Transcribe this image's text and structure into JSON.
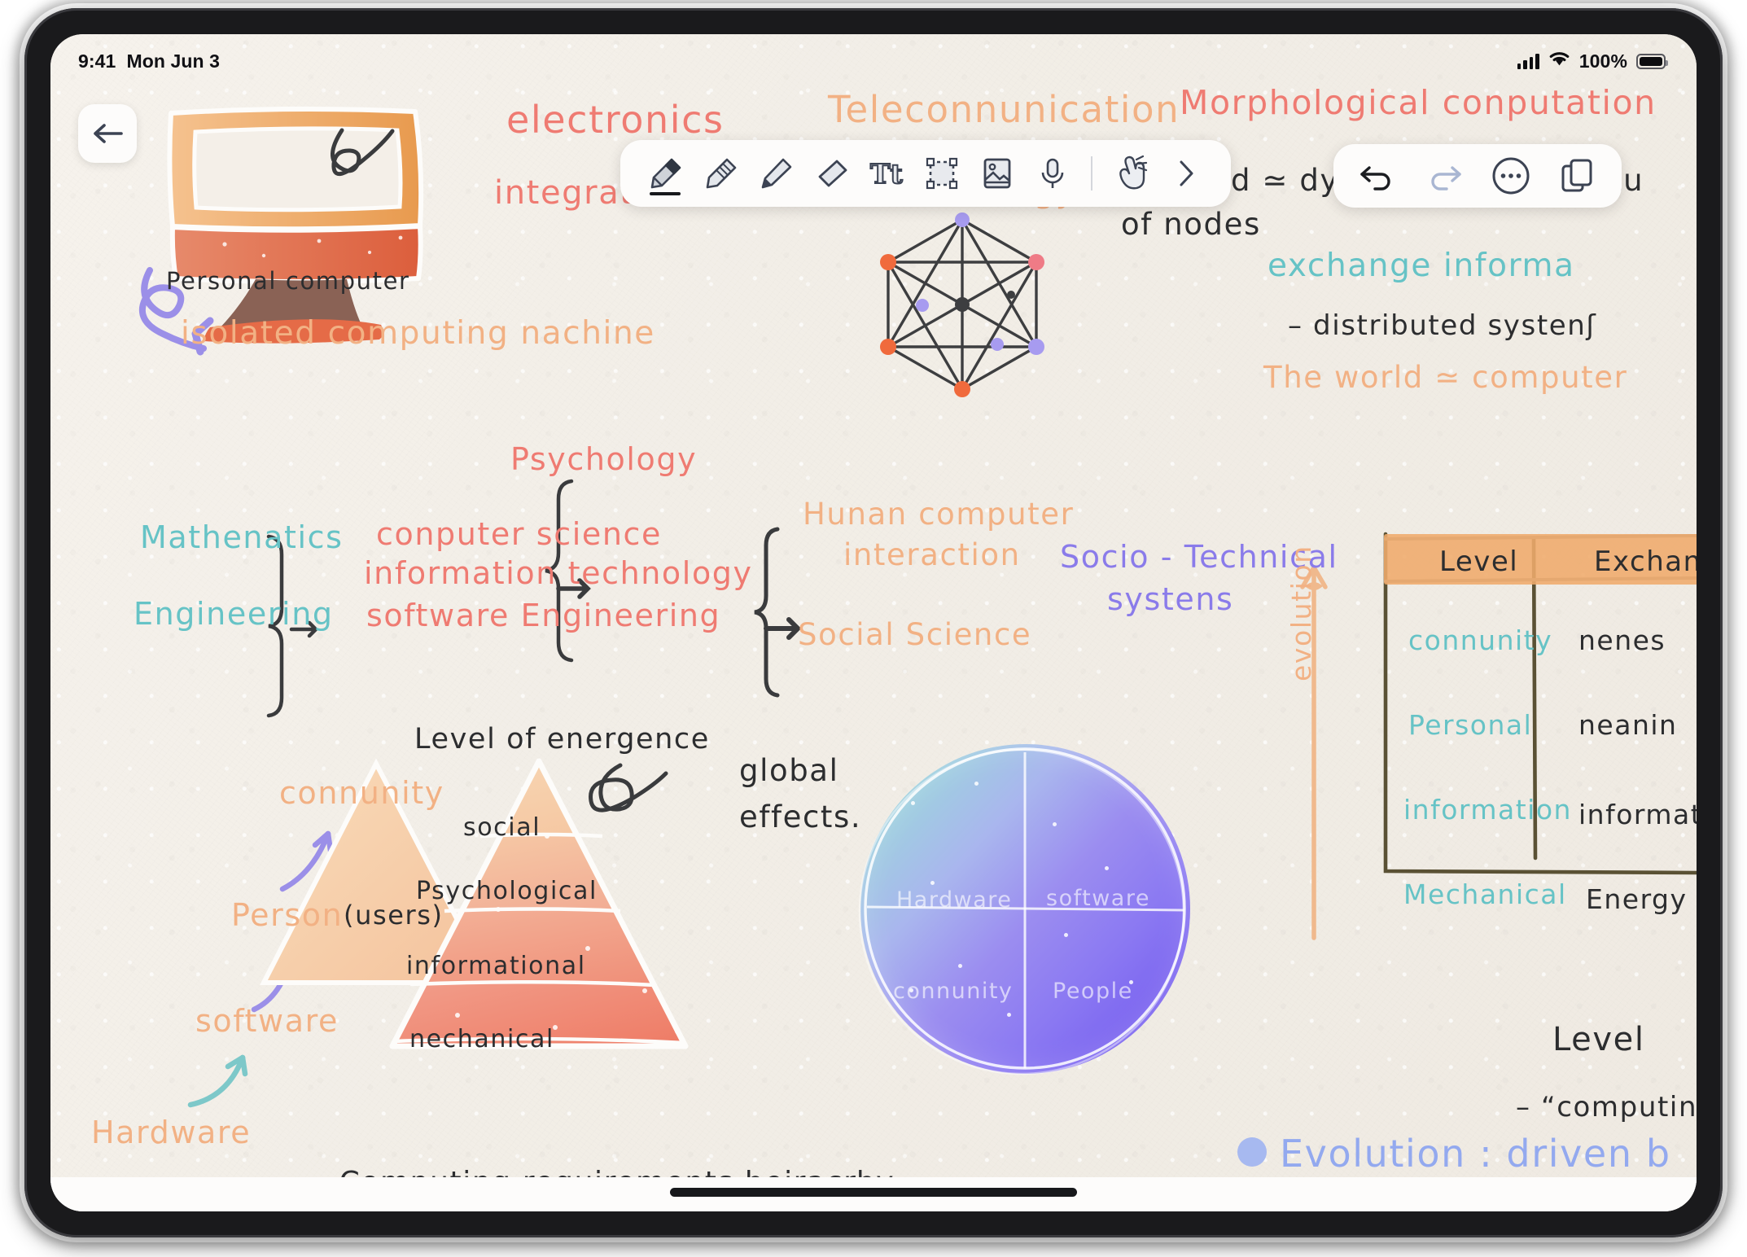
{
  "status_bar": {
    "time": "9:41",
    "date": "Mon Jun 3",
    "battery_percent": "100%",
    "icons": [
      "cellular-signal-icon",
      "wifi-icon",
      "battery-icon"
    ]
  },
  "nav": {
    "back_label": "←"
  },
  "pen_toolbar": {
    "tools": [
      {
        "name": "pen-tool",
        "label": "Pen",
        "selected": true
      },
      {
        "name": "pencil-tool",
        "label": "Pencil",
        "selected": false
      },
      {
        "name": "highlighter-tool",
        "label": "Highlighter",
        "selected": false
      },
      {
        "name": "eraser-tool",
        "label": "Eraser",
        "selected": false
      },
      {
        "name": "text-tool",
        "label": "Tt",
        "selected": false
      },
      {
        "name": "lasso-select-tool",
        "label": "Select",
        "selected": false
      },
      {
        "name": "insert-image-tool",
        "label": "Image",
        "selected": false
      },
      {
        "name": "audio-record-tool",
        "label": "Record",
        "selected": false
      },
      {
        "name": "hand-tool",
        "label": "Hand",
        "selected": false
      },
      {
        "name": "expand-toolbar",
        "label": "›",
        "selected": false
      }
    ]
  },
  "action_toolbar": {
    "undo_label": "Undo",
    "redo_label": "Redo",
    "more_label": "More",
    "pages_label": "Pages",
    "undo_enabled": true,
    "redo_enabled": false
  },
  "notes": {
    "monitor_caption": "Personal  computer",
    "isolated": "isolated  computing  nachine",
    "electronics": "electronics",
    "integrated_circuit": "integrated  circuit",
    "telecommunication": "Teleconnunication",
    "technology": "Technology",
    "morphological": "Morphological  conputation",
    "modeled_line1": "nodeled ≃ dynanics of a structu",
    "modeled_line2": "of nodes",
    "exchange_info": "exchange  informa",
    "distributed_systems": "– distributed  systenʃ",
    "world_computer": "The world ≃ computer",
    "mathematics": "Mathenatics",
    "engineering": "Engineering",
    "psychology": "Psychology",
    "computer_science": "conputer  science",
    "information_technology": "information technology",
    "software_engineering": "software Engineering",
    "hci_line1": "Hunan  computer",
    "hci_line2": "interaction",
    "social_science": "Social  Science",
    "socio_technical_line1": "Socio - Technical",
    "socio_technical_line2": "systens",
    "level_of_emergence": "Level  of  energence",
    "global_line1": "global",
    "global_line2": "effects.",
    "pyramid_left_labels": [
      "connunity",
      "Person",
      "software",
      "Hardware"
    ],
    "person_users_suffix": "(users)",
    "pyramid_layers": [
      "social",
      "Psychological",
      "informational",
      "nechanical"
    ],
    "sphere_quadrants": [
      "Hardware",
      "software",
      "connunity",
      "People"
    ],
    "evolution_axis": "evolution",
    "table": {
      "headers": [
        "Level",
        "Exchang"
      ],
      "rows": [
        {
          "level": "connunity",
          "exchange": "nenes"
        },
        {
          "level": "Personal",
          "exchange": "neanin"
        },
        {
          "level": "information",
          "exchange": "informati"
        },
        {
          "level": "Mechanical",
          "exchange": "Energy"
        }
      ]
    },
    "level_caption": "Level",
    "computing_note": "– “computing i",
    "evolution_bullet": "Evolution : driven b",
    "bottom_caption": "–  Computing  requirements  heiracrhy  –"
  },
  "colors": {
    "paper": "#f2eee7",
    "ink_dark": "#2c2d2f",
    "ink_red": "#ef7b72",
    "ink_orange": "#f0a86e",
    "ink_peach": "#f2b184",
    "ink_teal": "#66c3c6",
    "ink_purple": "#8a7bea",
    "ink_blue": "#93a9ef",
    "table_header": "#f0ab6c",
    "pyramid_top": "#f7d3ac",
    "pyramid_bottom": "#ef7256",
    "sphere_teal": "#8fd4d2",
    "sphere_purple": "#6f56ee"
  }
}
